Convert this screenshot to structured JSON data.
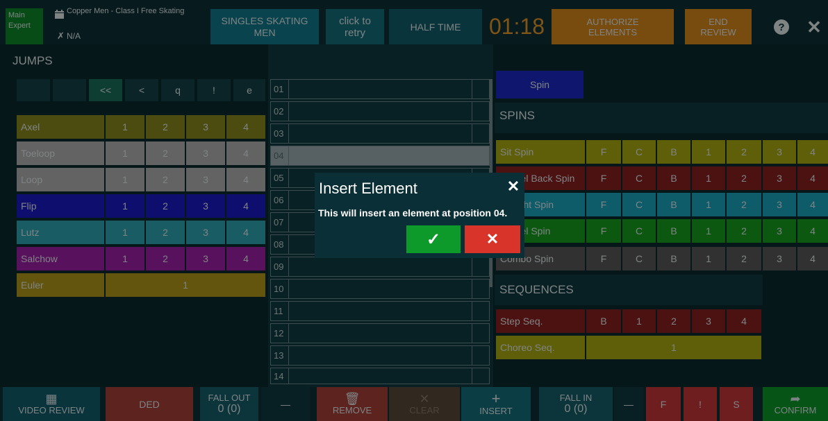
{
  "topbar": {
    "judge_role": "Main",
    "judge_title": "Expert",
    "event_name": "Copper Men - Class I Free Skating",
    "skater": "N/A",
    "discipline": "SINGLES SKATING MEN",
    "retry": "click to retry",
    "half_time": "HALF TIME",
    "timer": "01:18",
    "authorize": "AUTHORIZE ELEMENTS",
    "end_review": "END REVIEW",
    "help_icon": "?",
    "close_icon": "✕"
  },
  "jumps": {
    "title": "JUMPS",
    "mods": [
      "<<",
      "<",
      "q",
      "!",
      "e"
    ],
    "rows": [
      {
        "name": "Axel",
        "values": [
          "1",
          "2",
          "3",
          "4"
        ],
        "color": "#8a8b1e"
      },
      {
        "name": "Toeloop",
        "values": [
          "1",
          "2",
          "3",
          "4"
        ],
        "color": "#b4b4b4"
      },
      {
        "name": "Loop",
        "values": [
          "1",
          "2",
          "3",
          "4"
        ],
        "color": "#b4b4b4"
      },
      {
        "name": "Flip",
        "values": [
          "1",
          "2",
          "3",
          "4"
        ],
        "color": "#1a1ac8"
      },
      {
        "name": "Lutz",
        "values": [
          "1",
          "2",
          "3",
          "4"
        ],
        "color": "#2ea8b4"
      },
      {
        "name": "Salchow",
        "values": [
          "1",
          "2",
          "3",
          "4"
        ],
        "color": "#a020a8"
      },
      {
        "name": "Euler",
        "values": [
          "1"
        ],
        "color": "#b49a1a"
      }
    ]
  },
  "elements_list": {
    "numbers": [
      "01",
      "02",
      "03",
      "04",
      "05",
      "06",
      "07",
      "08",
      "09",
      "10",
      "11",
      "12",
      "13",
      "14"
    ]
  },
  "spins": {
    "button": "Spin",
    "title": "SPINS",
    "levels": [
      "F",
      "C",
      "B",
      "1",
      "2",
      "3",
      "4"
    ],
    "rows": [
      {
        "name": "Sit Spin",
        "color": "#b0ae12"
      },
      {
        "name": "Camel Back Spin",
        "color": "#8a2020"
      },
      {
        "name": "Upright Spin",
        "color": "#1aa8c0"
      },
      {
        "name": "Camel Spin",
        "color": "#18a020"
      },
      {
        "name": "Combo Spin",
        "color": "#5a5a5a"
      }
    ]
  },
  "sequences": {
    "title": "SEQUENCES",
    "step_label": "Step Seq.",
    "step_values": [
      "B",
      "1",
      "2",
      "3",
      "4"
    ],
    "choreo_label": "Choreo Seq.",
    "choreo_value": "1"
  },
  "bottombar": {
    "video_review": "VIDEO REVIEW",
    "ded": "DED",
    "fall_out_label": "FALL OUT",
    "fall_out_value": "0 (0)",
    "minus": "—",
    "remove": "REMOVE",
    "clear": "CLEAR",
    "insert": "INSERT",
    "fall_in_label": "FALL IN",
    "fall_in_value": "0 (0)",
    "minus2": "—",
    "f": "F",
    "excl": "!",
    "s": "S",
    "confirm": "CONFIRM"
  },
  "dialog": {
    "title": "Insert Element",
    "message": "This will insert an element at position 04.",
    "close": "✕",
    "ok": "✓",
    "cancel": "✕"
  },
  "colors": {
    "background": "#0b2a30",
    "teal": "#127a8c",
    "orange": "#d98a1a",
    "green": "#0e9a2a",
    "red": "#d8342a"
  }
}
